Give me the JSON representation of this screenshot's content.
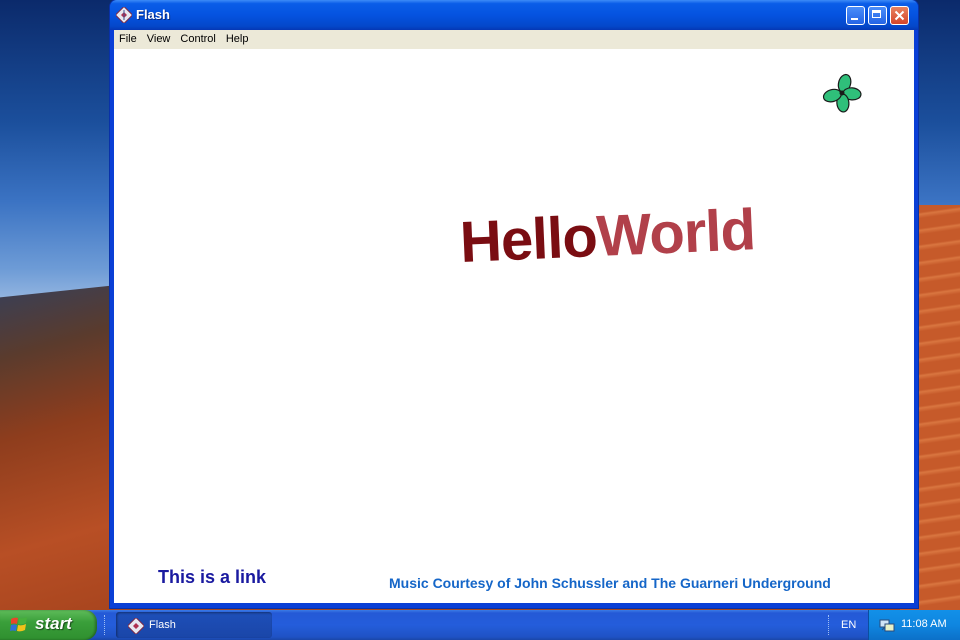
{
  "window": {
    "title": "Flash",
    "menu": [
      "File",
      "View",
      "Control",
      "Help"
    ]
  },
  "content": {
    "headline_part1": "Hello",
    "headline_part2": "World",
    "link_text": "This is a link",
    "credits": "Music Courtesy of John Schussler and The Guarneri Underground"
  },
  "taskbar": {
    "start_label": "start",
    "task_label": "Flash",
    "language": "EN",
    "clock": "11:08 AM"
  },
  "colors": {
    "headline_dark": "#7a0d12",
    "headline_light": "#b1404a",
    "link": "#1a1aa0",
    "credits": "#1566c8",
    "title_bar": "#0553e0",
    "start_button": "#3a9f3a"
  },
  "icons": {
    "window_icon": "flash-icon",
    "decor": "green-flower-icon",
    "start": "windows-logo-icon",
    "tray": "network-icon"
  }
}
